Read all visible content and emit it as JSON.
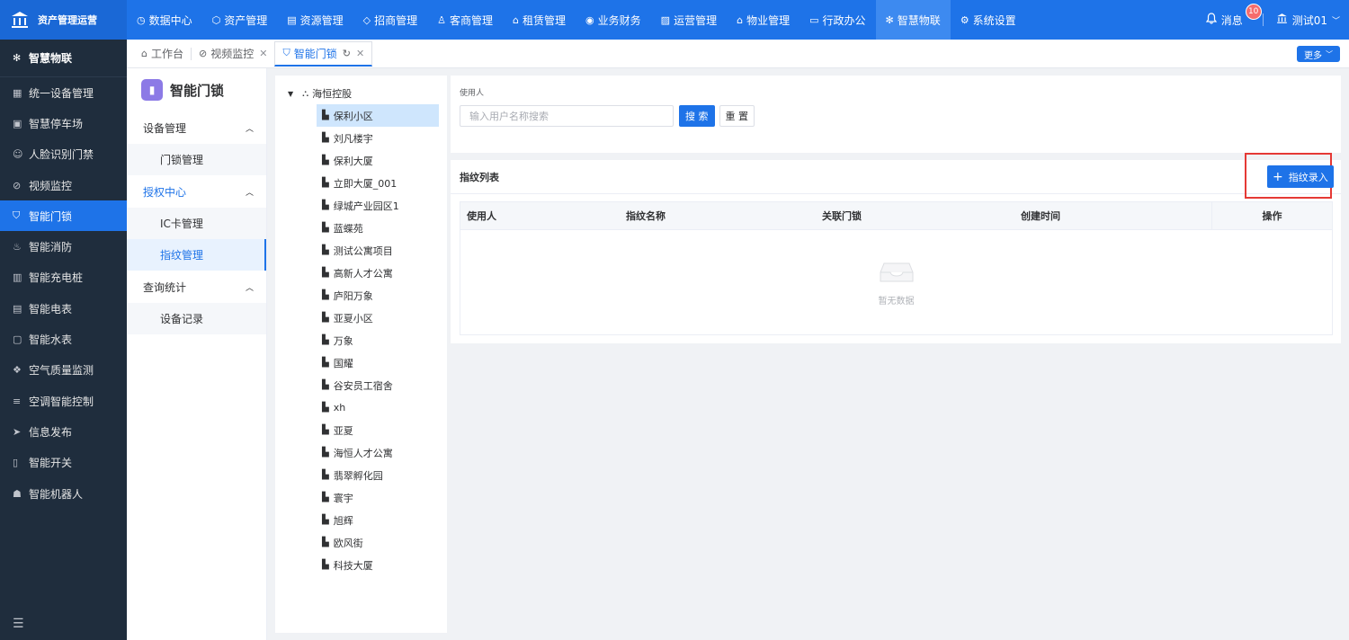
{
  "app": {
    "title": "资产管理运营"
  },
  "colors": {
    "primary": "#1e73e8",
    "sidebar_bg": "#1f2d3d",
    "highlight": "#e53935"
  },
  "topnav": {
    "items": [
      {
        "label": "数据中心",
        "icon": "dashboard-icon"
      },
      {
        "label": "资产管理",
        "icon": "cube-icon"
      },
      {
        "label": "资源管理",
        "icon": "document-icon"
      },
      {
        "label": "招商管理",
        "icon": "tag-icon"
      },
      {
        "label": "客商管理",
        "icon": "users-icon"
      },
      {
        "label": "租赁管理",
        "icon": "home-icon"
      },
      {
        "label": "业务财务",
        "icon": "money-icon"
      },
      {
        "label": "运营管理",
        "icon": "chart-icon"
      },
      {
        "label": "物业管理",
        "icon": "building-icon"
      },
      {
        "label": "行政办公",
        "icon": "monitor-icon"
      },
      {
        "label": "智慧物联",
        "icon": "atom-icon"
      },
      {
        "label": "系统设置",
        "icon": "gear-icon"
      }
    ],
    "active_index": 10
  },
  "topright": {
    "message_label": "消息",
    "message_count": "10",
    "user_name": "测试01"
  },
  "sidebar": {
    "header": "智慧物联",
    "items": [
      {
        "label": "统一设备管理"
      },
      {
        "label": "智慧停车场"
      },
      {
        "label": "人脸识别门禁"
      },
      {
        "label": "视频监控"
      },
      {
        "label": "智能门锁"
      },
      {
        "label": "智能消防"
      },
      {
        "label": "智能充电桩"
      },
      {
        "label": "智能电表"
      },
      {
        "label": "智能水表"
      },
      {
        "label": "空气质量监测"
      },
      {
        "label": "空调智能控制"
      },
      {
        "label": "信息发布"
      },
      {
        "label": "智能开关"
      },
      {
        "label": "智能机器人"
      }
    ],
    "active_index": 4
  },
  "tabs": {
    "items": [
      {
        "label": "工作台"
      },
      {
        "label": "视频监控"
      },
      {
        "label": "智能门锁"
      }
    ],
    "more_label": "更多"
  },
  "submenu": {
    "title": "智能门锁",
    "groups": [
      {
        "label": "设备管理",
        "items": [
          "门锁管理"
        ]
      },
      {
        "label": "授权中心",
        "items": [
          "IC卡管理",
          "指纹管理"
        ]
      },
      {
        "label": "查询统计",
        "items": [
          "设备记录"
        ]
      }
    ]
  },
  "tree": {
    "root": "海恒控股",
    "nodes": [
      "保利小区",
      "刘凡楼宇",
      "保利大厦",
      "立即大厦_001",
      "绿城产业园区1",
      "蓝蝶苑",
      "测试公寓项目",
      "高新人才公寓",
      "庐阳万象",
      "亚夏小区",
      "万象",
      "国耀",
      "谷安员工宿舍",
      "xh",
      "亚夏",
      "海恒人才公寓",
      "翡翠孵化园",
      "寰宇",
      "旭辉",
      "欧风街",
      "科技大厦"
    ],
    "selected_index": 0
  },
  "search": {
    "label": "使用人",
    "placeholder": "输入用户名称搜索",
    "search_label": "搜 索",
    "reset_label": "重 置"
  },
  "list": {
    "title": "指纹列表",
    "add_label": "指纹录入",
    "columns": [
      "使用人",
      "指纹名称",
      "关联门锁",
      "创建时间",
      "操作"
    ],
    "empty_text": "暂无数据"
  }
}
